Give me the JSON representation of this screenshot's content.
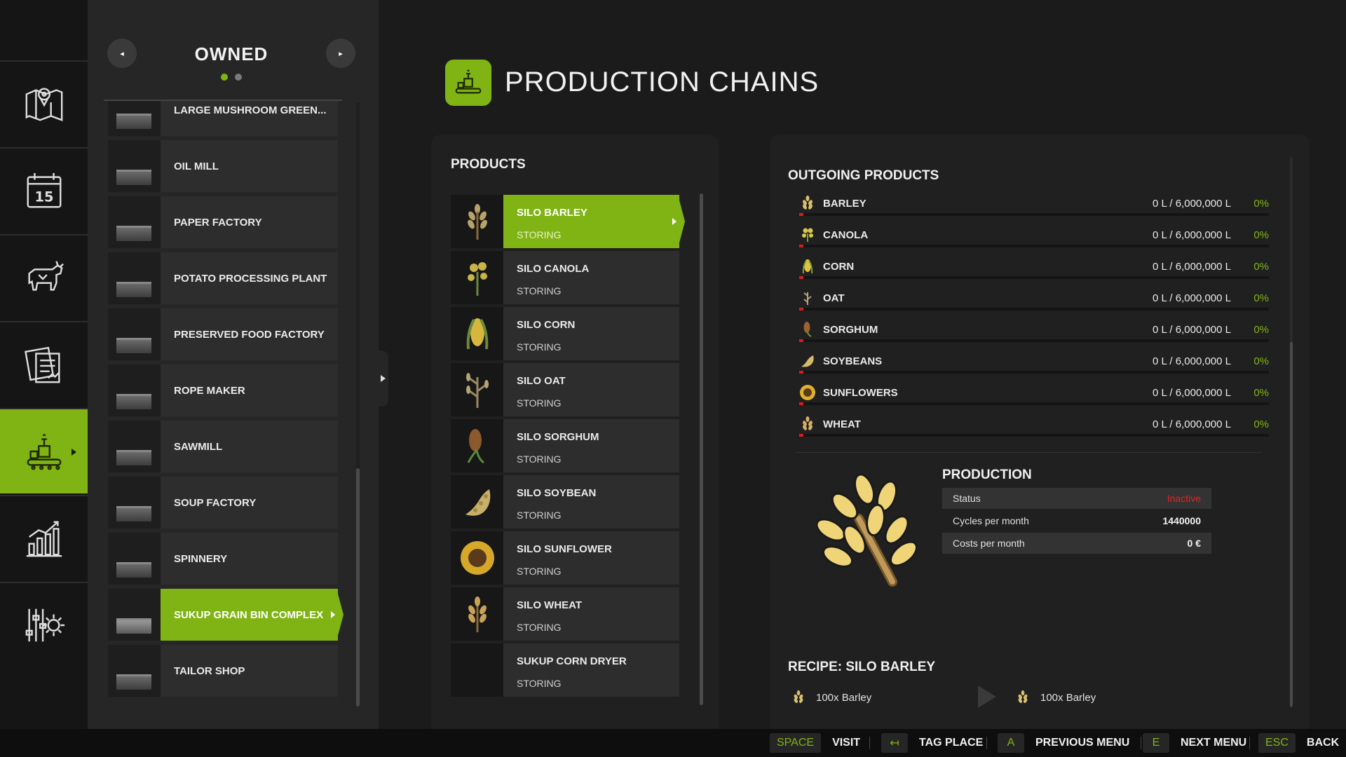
{
  "nav": {
    "items": [
      {
        "id": "map",
        "icon": "map-icon"
      },
      {
        "id": "calendar",
        "icon": "calendar-icon",
        "label": "15"
      },
      {
        "id": "animals",
        "icon": "cow-icon"
      },
      {
        "id": "contracts",
        "icon": "contracts-icon"
      },
      {
        "id": "production",
        "icon": "production-icon",
        "active": true
      },
      {
        "id": "statistics",
        "icon": "chart-icon"
      },
      {
        "id": "settings",
        "icon": "settings-icon"
      }
    ]
  },
  "owned": {
    "title": "OWNED",
    "prev_icon": "◂",
    "next_icon": "▸",
    "page_count": 2,
    "current_page": 1,
    "items": [
      {
        "label": "LARGE MUSHROOM GREEN..."
      },
      {
        "label": "OIL MILL"
      },
      {
        "label": "PAPER FACTORY"
      },
      {
        "label": "POTATO PROCESSING PLANT"
      },
      {
        "label": "PRESERVED FOOD FACTORY"
      },
      {
        "label": "ROPE MAKER"
      },
      {
        "label": "SAWMILL"
      },
      {
        "label": "SOUP FACTORY"
      },
      {
        "label": "SPINNERY"
      },
      {
        "label": "SUKUP GRAIN BIN COMPLEX",
        "active": true
      },
      {
        "label": "TAILOR SHOP"
      }
    ]
  },
  "header": {
    "title": "PRODUCTION CHAINS"
  },
  "products": {
    "heading": "PRODUCTS",
    "items": [
      {
        "name": "SILO BARLEY",
        "status": "STORING",
        "icon": "barley-icon",
        "active": true
      },
      {
        "name": "SILO CANOLA",
        "status": "STORING",
        "icon": "canola-icon"
      },
      {
        "name": "SILO CORN",
        "status": "STORING",
        "icon": "corn-icon"
      },
      {
        "name": "SILO OAT",
        "status": "STORING",
        "icon": "oat-icon"
      },
      {
        "name": "SILO SORGHUM",
        "status": "STORING",
        "icon": "sorghum-icon"
      },
      {
        "name": "SILO SOYBEAN",
        "status": "STORING",
        "icon": "soybean-icon"
      },
      {
        "name": "SILO SUNFLOWER",
        "status": "STORING",
        "icon": "sunflower-icon"
      },
      {
        "name": "SILO WHEAT",
        "status": "STORING",
        "icon": "wheat-icon"
      },
      {
        "name": "SUKUP CORN DRYER",
        "status": "STORING",
        "icon": ""
      }
    ]
  },
  "outgoing": {
    "heading": "OUTGOING PRODUCTS",
    "items": [
      {
        "name": "BARLEY",
        "amount": "0 L / 6,000,000 L",
        "percent": "0%",
        "fill": 0,
        "icon": "barley-icon"
      },
      {
        "name": "CANOLA",
        "amount": "0 L / 6,000,000 L",
        "percent": "0%",
        "fill": 0,
        "icon": "canola-icon"
      },
      {
        "name": "CORN",
        "amount": "0 L / 6,000,000 L",
        "percent": "0%",
        "fill": 0,
        "icon": "corn-icon"
      },
      {
        "name": "OAT",
        "amount": "0 L / 6,000,000 L",
        "percent": "0%",
        "fill": 0,
        "icon": "oat-icon"
      },
      {
        "name": "SORGHUM",
        "amount": "0 L / 6,000,000 L",
        "percent": "0%",
        "fill": 0,
        "icon": "sorghum-icon"
      },
      {
        "name": "SOYBEANS",
        "amount": "0 L / 6,000,000 L",
        "percent": "0%",
        "fill": 0,
        "icon": "soybean-icon"
      },
      {
        "name": "SUNFLOWERS",
        "amount": "0 L / 6,000,000 L",
        "percent": "0%",
        "fill": 0,
        "icon": "sunflower-icon"
      },
      {
        "name": "WHEAT",
        "amount": "0 L / 6,000,000 L",
        "percent": "0%",
        "fill": 0,
        "icon": "wheat-icon"
      }
    ]
  },
  "production": {
    "heading": "PRODUCTION",
    "icon": "barley-icon",
    "stats": [
      {
        "label": "Status",
        "value": "Inactive",
        "value_color": "#e3241d"
      },
      {
        "label": "Cycles per month",
        "value": "1440000"
      },
      {
        "label": "Costs per month",
        "value": "0 €"
      }
    ]
  },
  "recipe": {
    "heading": "RECIPE: SILO BARLEY",
    "input": "100x Barley",
    "output": "100x Barley"
  },
  "bottom": {
    "hints": [
      {
        "key": "SPACE",
        "label": "VISIT"
      },
      {
        "key": "↤",
        "label": "TAG PLACE"
      },
      {
        "key": "A",
        "label": "PREVIOUS MENU"
      },
      {
        "key": "E",
        "label": "NEXT MENU"
      },
      {
        "key": "ESC",
        "label": "BACK"
      }
    ]
  },
  "colors": {
    "accent": "#80b414",
    "inactive": "#e3241d"
  }
}
